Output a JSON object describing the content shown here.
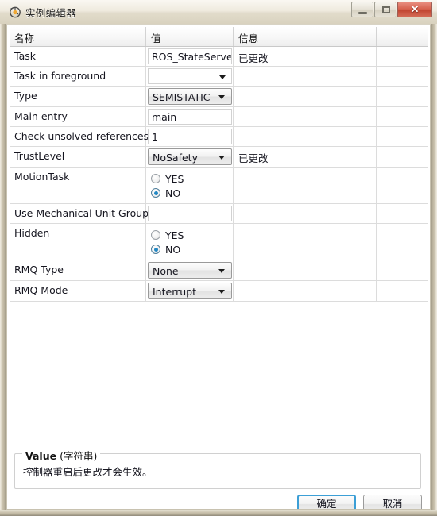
{
  "window": {
    "title": "实例编辑器",
    "icon": "instance-editor-icon",
    "minimize_tooltip": "最小化",
    "restore_tooltip": "还原",
    "close_tooltip": "关闭"
  },
  "table": {
    "columns": [
      "名称",
      "值",
      "信息",
      ""
    ],
    "rows": [
      {
        "name": "Task",
        "widget": "text",
        "value": "ROS_StateServer",
        "info": "已更改"
      },
      {
        "name": "Task in foreground",
        "widget": "flatcombo",
        "value": "",
        "info": ""
      },
      {
        "name": "Type",
        "widget": "combo",
        "value": "SEMISTATIC",
        "info": ""
      },
      {
        "name": "Main entry",
        "widget": "text",
        "value": "main",
        "info": ""
      },
      {
        "name": "Check unsolved references",
        "widget": "text",
        "value": "1",
        "info": ""
      },
      {
        "name": "TrustLevel",
        "widget": "combo",
        "value": "NoSafety",
        "info": "已更改"
      },
      {
        "name": "MotionTask",
        "widget": "radio",
        "options": [
          "YES",
          "NO"
        ],
        "value": "NO",
        "info": ""
      },
      {
        "name": "Use Mechanical Unit Group",
        "widget": "text",
        "value": "",
        "info": ""
      },
      {
        "name": "Hidden",
        "widget": "radio",
        "options": [
          "YES",
          "NO"
        ],
        "value": "NO",
        "info": ""
      },
      {
        "name": "RMQ Type",
        "widget": "combo",
        "value": "None",
        "info": ""
      },
      {
        "name": "RMQ Mode",
        "widget": "combo",
        "value": "Interrupt",
        "info": ""
      }
    ]
  },
  "groupbox": {
    "title_strong": "Value",
    "title_rest": " (字符串)",
    "description": "控制器重启后更改才会生效。"
  },
  "buttons": {
    "ok": "确定",
    "cancel": "取消"
  },
  "colors": {
    "accent_focus": "#3c9fd6",
    "radio_selected": "#2388c4",
    "close_button": "#c0422f"
  }
}
